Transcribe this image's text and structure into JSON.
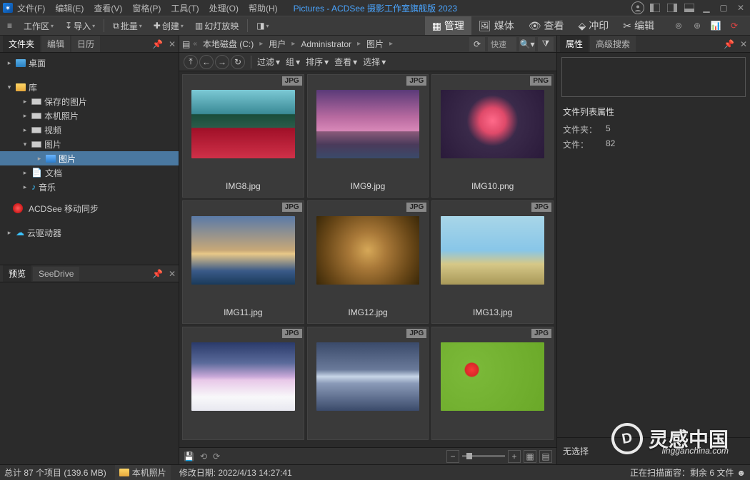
{
  "titlebar": {
    "menus": [
      "文件(F)",
      "编辑(E)",
      "查看(V)",
      "窗格(P)",
      "工具(T)",
      "处理(O)",
      "帮助(H)"
    ],
    "app_title": "Pictures - ACDSee 摄影工作室旗舰版 2023"
  },
  "toolbar": {
    "workspace": "工作区",
    "import": "导入",
    "batch": "批量",
    "create": "创建",
    "slideshow": "幻灯放映"
  },
  "modes": {
    "manage": "管理",
    "media": "媒体",
    "view": "查看",
    "develop": "冲印",
    "edit": "编辑"
  },
  "left": {
    "tabs": {
      "folders": "文件夹",
      "edit": "编辑",
      "calendar": "日历"
    },
    "tree": {
      "desktop": "桌面",
      "library": "库",
      "saved": "保存的图片",
      "local": "本机照片",
      "video": "视频",
      "pictures": "图片",
      "pictures_sub": "图片",
      "docs": "文档",
      "music": "音乐",
      "acdsync": "ACDSee 移动同步",
      "cloud": "云驱动器"
    },
    "preview_tabs": {
      "preview": "预览",
      "seedrive": "SeeDrive"
    }
  },
  "address": {
    "root": "本地磁盘 (C:)",
    "users": "用户",
    "admin": "Administrator",
    "pics": "图片",
    "quick": "快速"
  },
  "filterbar": {
    "filter": "过滤",
    "group": "组",
    "sort": "排序",
    "view": "查看",
    "select": "选择"
  },
  "thumbs": [
    {
      "badge": "JPG",
      "name": "IMG8.jpg",
      "art": "img1"
    },
    {
      "badge": "JPG",
      "name": "IMG9.jpg",
      "art": "img2"
    },
    {
      "badge": "PNG",
      "name": "IMG10.png",
      "art": "img3"
    },
    {
      "badge": "JPG",
      "name": "IMG11.jpg",
      "art": "img4"
    },
    {
      "badge": "JPG",
      "name": "IMG12.jpg",
      "art": "img5"
    },
    {
      "badge": "JPG",
      "name": "IMG13.jpg",
      "art": "img6"
    },
    {
      "badge": "JPG",
      "name": "",
      "art": "img7"
    },
    {
      "badge": "JPG",
      "name": "",
      "art": "img8"
    },
    {
      "badge": "JPG",
      "name": "",
      "art": "img9"
    }
  ],
  "right": {
    "tabs": {
      "props": "属性",
      "advsearch": "高级搜索"
    },
    "list_props_heading": "文件列表属性",
    "folders_k": "文件夹：",
    "folders_v": "5",
    "files_k": "文件：",
    "files_v": "82",
    "no_selection": "无选择"
  },
  "status": {
    "total": "总计 87 个项目 (139.6 MB)",
    "localphotos": "本机照片",
    "modified": "修改日期: 2022/4/13 14:27:41",
    "scanning": "正在扫描面容：剩余 6 文件"
  },
  "watermark": {
    "cn": "灵感中国",
    "en": "lingganchina.com"
  }
}
